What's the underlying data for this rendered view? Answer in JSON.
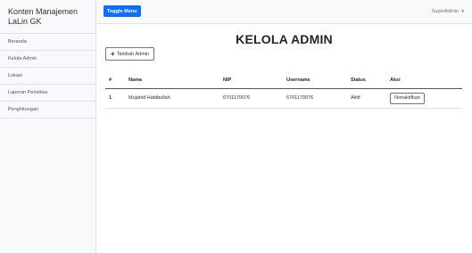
{
  "sidebar": {
    "title": "Konten Manajemen LaLin GK",
    "items": [
      {
        "label": "Beranda"
      },
      {
        "label": "Kelola Admin"
      },
      {
        "label": "Lokasi"
      },
      {
        "label": "Laporan Peristiwa"
      },
      {
        "label": "Penghitungan"
      }
    ]
  },
  "topbar": {
    "toggle_label": "Toggle Menu",
    "user_label": "SuperAdmin",
    "caret_icon": "caret-down-icon"
  },
  "main": {
    "title": "KELOLA ADMIN",
    "add_button_label": "Tambah Admin",
    "add_button_icon": "plus-icon"
  },
  "table": {
    "headers": [
      "#",
      "Nama",
      "NIP",
      "Username",
      "Status",
      "Aksi"
    ],
    "rows": [
      {
        "no": "1",
        "nama": "Mujahid Habibullah",
        "nip": "6701170076",
        "username": "6701170076",
        "status": "Aktif",
        "action": "Nonaktifkan"
      }
    ]
  },
  "colors": {
    "primary": "#0d6efd",
    "sidebar_bg": "#f8f9fa",
    "border": "#dee2e6"
  }
}
